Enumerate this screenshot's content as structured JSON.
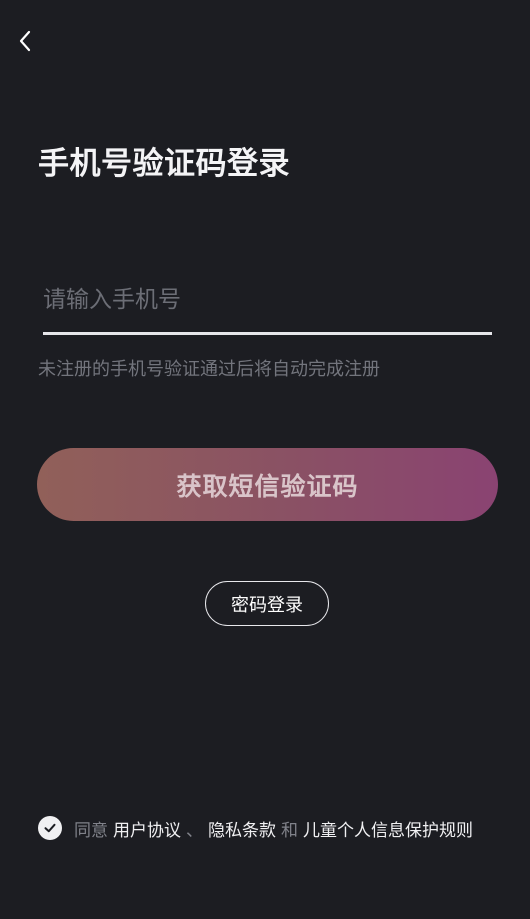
{
  "header": {
    "back_icon": "chevron-left-icon"
  },
  "title": "手机号验证码登录",
  "phone_input": {
    "placeholder": "请输入手机号",
    "value": ""
  },
  "hint": "未注册的手机号验证通过后将自动完成注册",
  "sms_button_label": "获取短信验证码",
  "password_login_label": "密码登录",
  "agreement": {
    "checked": true,
    "check_icon": "check-circle-icon",
    "prefix": "同意",
    "user_agreement": "用户协议",
    "separator": "、",
    "privacy_terms": "隐私条款",
    "conjunction": "和",
    "child_privacy": "儿童个人信息保护规则"
  },
  "colors": {
    "background": "#1c1d22",
    "button_gradient_start": "#916059",
    "button_gradient_end": "#8a4372",
    "muted_text": "#73757d"
  }
}
